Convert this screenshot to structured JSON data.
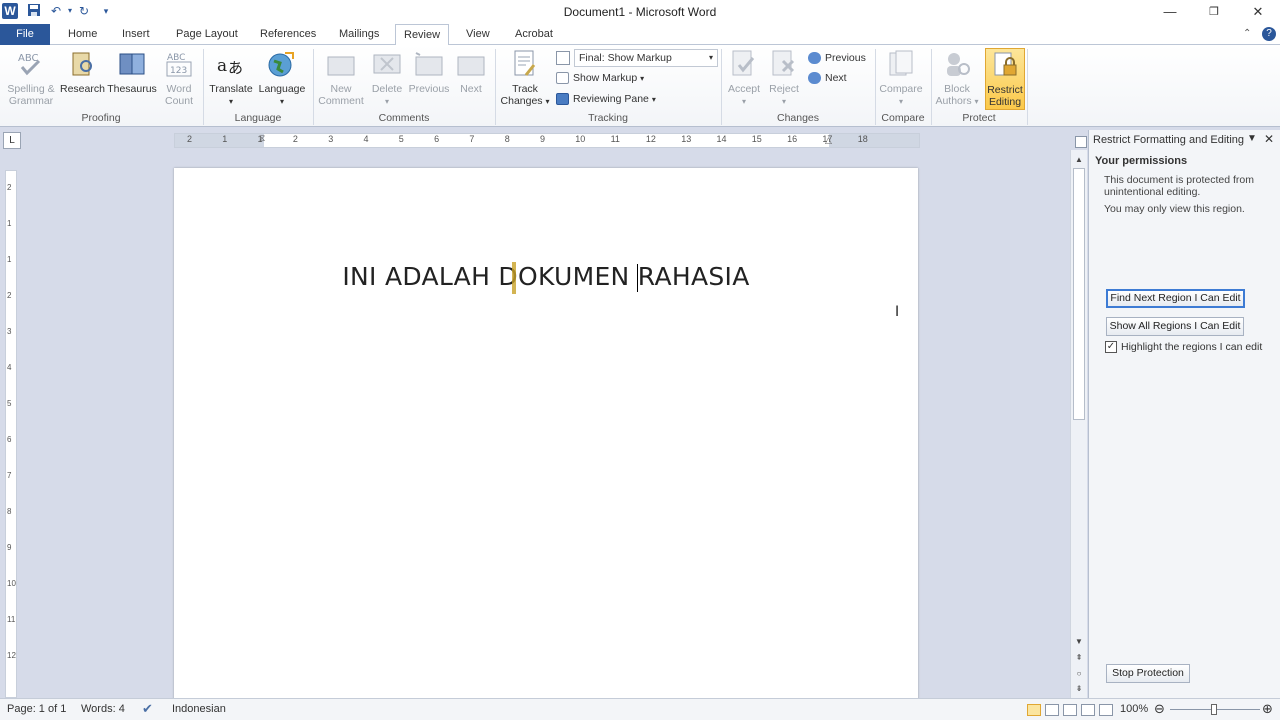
{
  "window": {
    "title": "Document1 - Microsoft Word"
  },
  "qat": {
    "word_icon": "W"
  },
  "tabs": [
    {
      "label": "File"
    },
    {
      "label": "Home"
    },
    {
      "label": "Insert"
    },
    {
      "label": "Page Layout"
    },
    {
      "label": "References"
    },
    {
      "label": "Mailings"
    },
    {
      "label": "Review"
    },
    {
      "label": "View"
    },
    {
      "label": "Acrobat"
    }
  ],
  "ribbon": {
    "proofing": {
      "label": "Proofing",
      "spelling": "Spelling &",
      "grammar": "Grammar",
      "research": "Research",
      "thesaurus": "Thesaurus",
      "word": "Word",
      "count": "Count"
    },
    "language": {
      "label": "Language",
      "translate": "Translate",
      "language": "Language"
    },
    "comments": {
      "label": "Comments",
      "new": "New",
      "comment": "Comment",
      "delete": "Delete",
      "previous": "Previous",
      "next": "Next"
    },
    "tracking": {
      "label": "Tracking",
      "track": "Track",
      "changes": "Changes",
      "markup_select": "Final: Show Markup",
      "show_markup": "Show Markup",
      "reviewing_pane": "Reviewing Pane"
    },
    "changes": {
      "label": "Changes",
      "accept": "Accept",
      "reject": "Reject",
      "previous": "Previous",
      "next": "Next"
    },
    "compare": {
      "label": "Compare",
      "compare": "Compare"
    },
    "protect": {
      "label": "Protect",
      "block": "Block",
      "authors": "Authors",
      "restrict": "Restrict",
      "editing": "Editing"
    }
  },
  "ruler": {
    "corner": "L",
    "h_ticks": [
      "2",
      "1",
      "1",
      "2",
      "3",
      "4",
      "5",
      "6",
      "7",
      "8",
      "9",
      "10",
      "11",
      "12",
      "13",
      "14",
      "15",
      "16",
      "17",
      "18"
    ],
    "v_ticks": [
      "2",
      "1",
      "1",
      "2",
      "3",
      "4",
      "5",
      "6",
      "7",
      "8",
      "9",
      "10",
      "11",
      "12"
    ]
  },
  "document": {
    "text": "INI ADALAH DOKUMEN RAHASIA"
  },
  "pane": {
    "title": "Restrict Formatting and Editing",
    "permissions_heading": "Your permissions",
    "protected_text": "This document is protected from unintentional editing.",
    "view_text": "You may only view this region.",
    "find_next_btn": "Find Next Region I Can Edit",
    "show_all_btn": "Show All Regions I Can Edit",
    "highlight_label": "Highlight the regions I can edit",
    "highlight_checked": true,
    "stop_btn": "Stop Protection"
  },
  "status": {
    "page": "Page: 1 of 1",
    "words": "Words: 4",
    "language": "Indonesian",
    "zoom": "100%"
  }
}
